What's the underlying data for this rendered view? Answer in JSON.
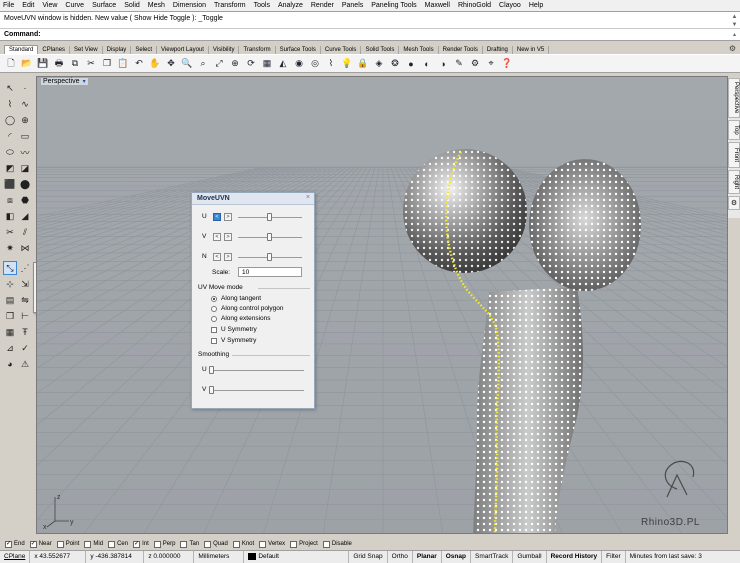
{
  "menu": [
    "File",
    "Edit",
    "View",
    "Curve",
    "Surface",
    "Solid",
    "Mesh",
    "Dimension",
    "Transform",
    "Tools",
    "Analyze",
    "Render",
    "Panels",
    "Paneling Tools",
    "Maxwell",
    "RhinoGold",
    "Clayoo",
    "Help"
  ],
  "command": {
    "history": "MoveUVN window is hidden. New value ( Show  Hide  Toggle ): _Toggle",
    "prompt": "Command:"
  },
  "toolbar_tabs": [
    "Standard",
    "CPlanes",
    "Set View",
    "Display",
    "Select",
    "Viewport Layout",
    "Visibility",
    "Transform",
    "Surface Tools",
    "Curve Tools",
    "Solid Tools",
    "Mesh Tools",
    "Render Tools",
    "Drafting",
    "New in V5"
  ],
  "active_tab": "Standard",
  "viewport": {
    "title": "Perspective",
    "side_tabs": [
      "Perspective",
      "Top",
      "Front",
      "Right"
    ],
    "watermark": "Rhino3D.PL",
    "axes": {
      "z": "z",
      "y": "y",
      "x": "x"
    }
  },
  "moveuvn": {
    "title": "MoveUVN",
    "u_label": "U",
    "v_label": "V",
    "n_label": "N",
    "scale_label": "Scale:",
    "scale_value": "10",
    "mode_header": "UV Move mode",
    "modes": [
      "Along tangent",
      "Along control polygon",
      "Along extensions"
    ],
    "selected_mode": "Along tangent",
    "u_symmetry": "U Symmetry",
    "v_symmetry": "V Symmetry",
    "smoothing_header": "Smoothing",
    "smooth_u": "U",
    "smooth_v": "V",
    "slider_u": 0.5,
    "slider_v": 0.5,
    "slider_n": 0.5,
    "smooth_u_value": 0,
    "smooth_v_value": 0
  },
  "osnap": [
    {
      "label": "End",
      "checked": true
    },
    {
      "label": "Near",
      "checked": true
    },
    {
      "label": "Point",
      "checked": false
    },
    {
      "label": "Mid",
      "checked": false
    },
    {
      "label": "Cen",
      "checked": false
    },
    {
      "label": "Int",
      "checked": true
    },
    {
      "label": "Perp",
      "checked": false
    },
    {
      "label": "Tan",
      "checked": false
    },
    {
      "label": "Quad",
      "checked": false
    },
    {
      "label": "Knot",
      "checked": false
    },
    {
      "label": "Vertex",
      "checked": false
    },
    {
      "label": "Project",
      "checked": false
    },
    {
      "label": "Disable",
      "checked": false
    }
  ],
  "status": {
    "cplane": "CPlane",
    "x": "x 43.552677",
    "y": "y -436.387814",
    "z": "z 0.000000",
    "units": "Millimeters",
    "layer": "Default",
    "grid_snap": "Grid Snap",
    "ortho": "Ortho",
    "planar": "Planar",
    "osnap": "Osnap",
    "smarttrack": "SmartTrack",
    "gumball": "Gumball",
    "record_history": "Record History",
    "filter": "Filter",
    "save_info": "Minutes from last save: 3"
  },
  "colors": {
    "viewport_bg": "#a1a6ab",
    "grid_line": "#8f959b",
    "control_points": "#ffffff",
    "selected_points": "#f2ea2a",
    "accent": "#3c86d6"
  }
}
